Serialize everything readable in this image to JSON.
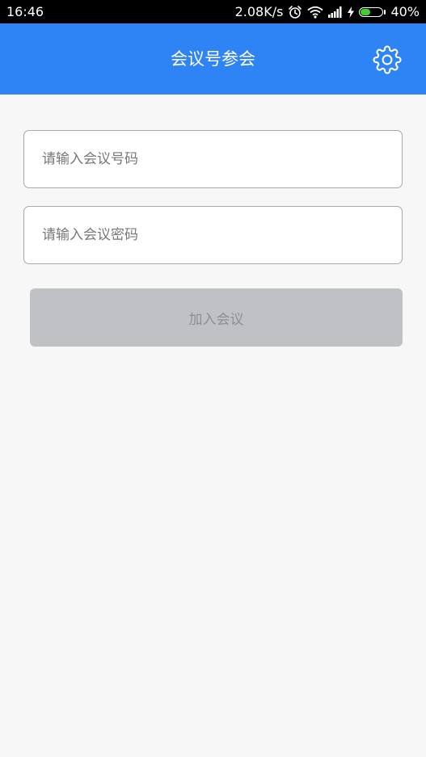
{
  "status_bar": {
    "time": "16:46",
    "net_speed": "2.08K/s",
    "battery_percent": "40%",
    "battery_level": 0.4,
    "icons": [
      "alarm-icon",
      "wifi-icon",
      "signal-icon",
      "charging-icon",
      "battery-icon"
    ]
  },
  "app_bar": {
    "title": "会议号参会",
    "settings_icon": "gear-icon",
    "background_color": "#2f84f5"
  },
  "form": {
    "meeting_number": {
      "value": "",
      "placeholder": "请输入会议号码"
    },
    "meeting_password": {
      "value": "",
      "placeholder": "请输入会议密码"
    },
    "join_button_label": "加入会议",
    "join_button_enabled": false
  }
}
